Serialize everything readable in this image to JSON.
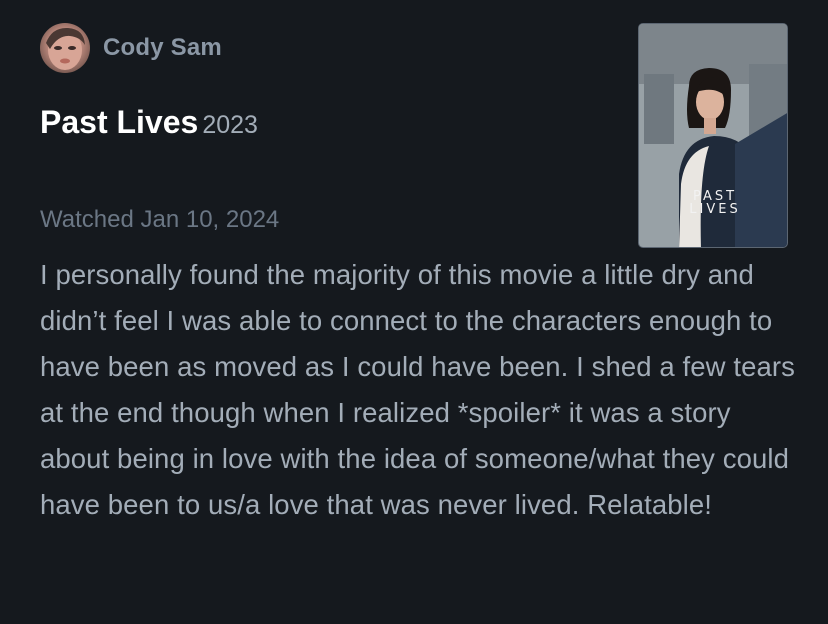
{
  "author": {
    "name": "Cody Sam",
    "avatar_icon": "user-avatar-icon"
  },
  "film": {
    "title": "Past Lives",
    "year": "2023",
    "poster_title_line1": "PAST",
    "poster_title_line2": "LIVES"
  },
  "review": {
    "watched": "Watched Jan 10, 2024",
    "body": "I personally found the majority of this movie a little dry and didn’t feel I was able to connect to the characters enough to have been as moved as I could have been. I shed a few tears at the end though when I realized *spoiler* it was a story about being in love with the idea of someone/what they could have been to us/a love that was never lived. Relatable!"
  },
  "colors": {
    "background": "#15191e",
    "author_name": "#8b97a5",
    "title": "#ffffff",
    "body_text": "#a3adb8",
    "watched_text": "#6b7785"
  }
}
